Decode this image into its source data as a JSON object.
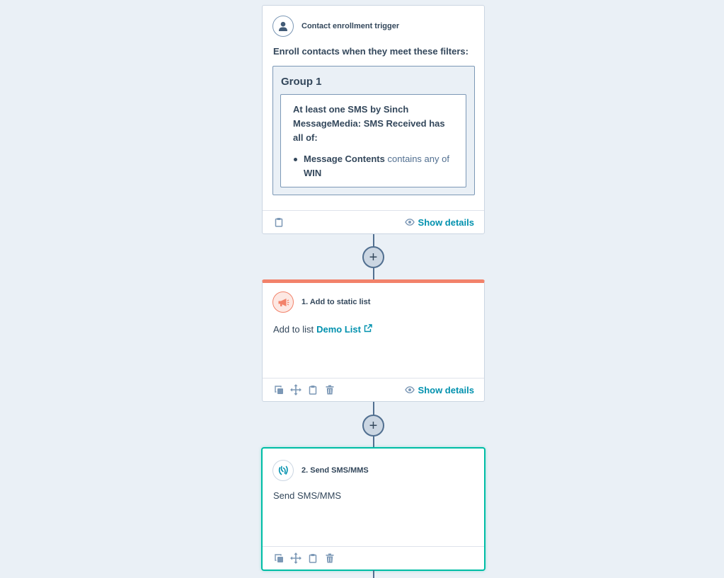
{
  "trigger": {
    "title": "Contact enrollment trigger",
    "intro": "Enroll contacts when they meet these filters:",
    "group": {
      "label": "Group 1",
      "filter_header": "At least one SMS by Sinch MessageMedia: SMS Received has all of:",
      "conditions": [
        {
          "property": "Message Contents",
          "operator": "contains any of",
          "value": "WIN"
        }
      ]
    },
    "show_details": "Show details"
  },
  "actions": [
    {
      "title": "1. Add to static list",
      "body_prefix": "Add to list",
      "link_text": "Demo List",
      "show_details": "Show details",
      "accent_color": "#f2826a"
    },
    {
      "title": "2. Send SMS/MMS",
      "body": "Send SMS/MMS",
      "selected": true,
      "accent_color": "#00bda5"
    }
  ],
  "add_button": {
    "label": "+"
  },
  "icons": {
    "trigger": "contact-person-icon",
    "action1": "megaphone-icon",
    "action2": "sms-app-icon",
    "footer": [
      "clone-icon",
      "move-icon",
      "clipboard-icon",
      "trash-icon"
    ],
    "show_details": "eye-icon",
    "external": "external-link-icon"
  }
}
